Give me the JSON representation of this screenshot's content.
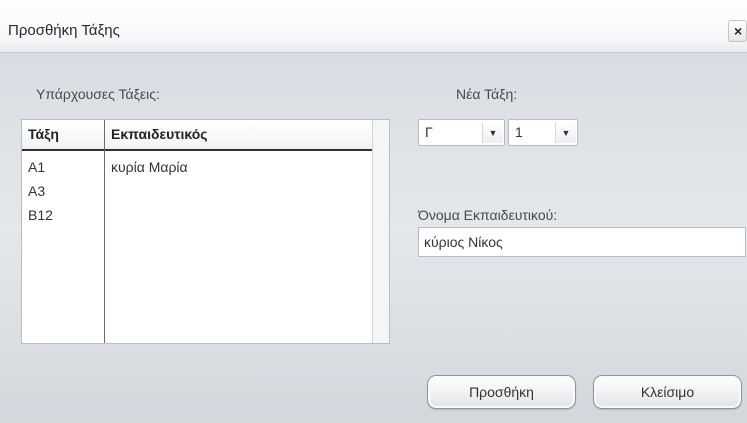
{
  "window": {
    "title": "Προσθήκη Τάξης",
    "close_glyph": "×"
  },
  "existing": {
    "label": "Υπάρχουσες Τάξεις:",
    "columns": [
      "Τάξη",
      "Εκπαιδευτικός"
    ],
    "rows": [
      {
        "class": "A1",
        "teacher": "κυρία Μαρία"
      },
      {
        "class": "A3",
        "teacher": ""
      },
      {
        "class": "B12",
        "teacher": ""
      }
    ]
  },
  "new_class": {
    "label": "Νέα Τάξη:",
    "letter_value": "Γ",
    "number_value": "1",
    "dropdown_arrow": "▼"
  },
  "teacher": {
    "label": "Όνομα Εκπαιδευτικού:",
    "value": "κύριος Νίκος"
  },
  "buttons": {
    "add": "Προσθήκη",
    "close": "Κλείσιμο"
  }
}
